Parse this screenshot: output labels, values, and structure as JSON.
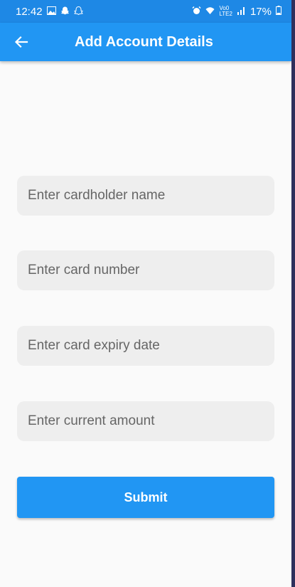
{
  "status_bar": {
    "time": "12:42",
    "volte_top": "Vo0",
    "volte_bottom": "LTE2",
    "battery": "17%",
    "icons": [
      "gallery-icon",
      "snapchat-icon",
      "snapchat-icon",
      "alarm-icon",
      "wifi-icon",
      "signal-icon",
      "battery-icon"
    ]
  },
  "app_bar": {
    "title": "Add Account Details",
    "back_icon": "arrow-left-icon"
  },
  "form": {
    "cardholder_placeholder": "Enter cardholder name",
    "card_number_placeholder": "Enter card number",
    "expiry_placeholder": "Enter card expiry date",
    "amount_placeholder": "Enter current amount",
    "submit_label": "Submit"
  },
  "colors": {
    "status_bar": "#1e88e5",
    "primary": "#2196f3",
    "field_background": "#eeeeee",
    "background": "#fafafa"
  }
}
